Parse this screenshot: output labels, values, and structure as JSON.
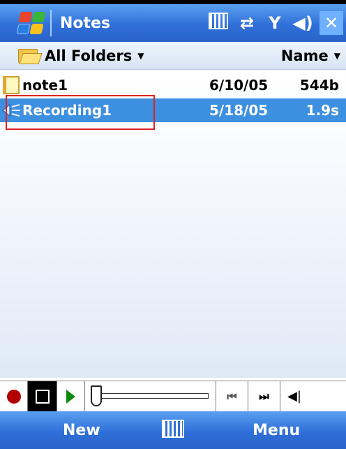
{
  "titlebar": {
    "app_title": "Notes",
    "icons": [
      "windows-start-icon",
      "input-panel-icon",
      "connectivity-icon",
      "signal-icon",
      "volume-icon",
      "close-icon"
    ],
    "close_label": "✕"
  },
  "header": {
    "folder_label": "All Folders",
    "sort_label": "Name"
  },
  "files": [
    {
      "name": "note1",
      "date": "6/10/05",
      "size": "544b",
      "icon": "note-icon",
      "selected": false
    },
    {
      "name": "Recording1",
      "date": "5/18/05",
      "size": "1.9s",
      "icon": "recording-icon",
      "selected": true
    }
  ],
  "playback": {
    "record_icon": "record-icon",
    "stop_icon": "stop-icon",
    "play_icon": "play-icon",
    "position": 0,
    "prev_label": "⏮",
    "next_label": "⏭",
    "volume_icon": "volume-icon"
  },
  "softkeys": {
    "left": "New",
    "right": "Menu"
  },
  "colors": {
    "titlebar": "#2f6fd8",
    "selection": "#3d8fe0",
    "highlight_outline": "#e02020"
  }
}
